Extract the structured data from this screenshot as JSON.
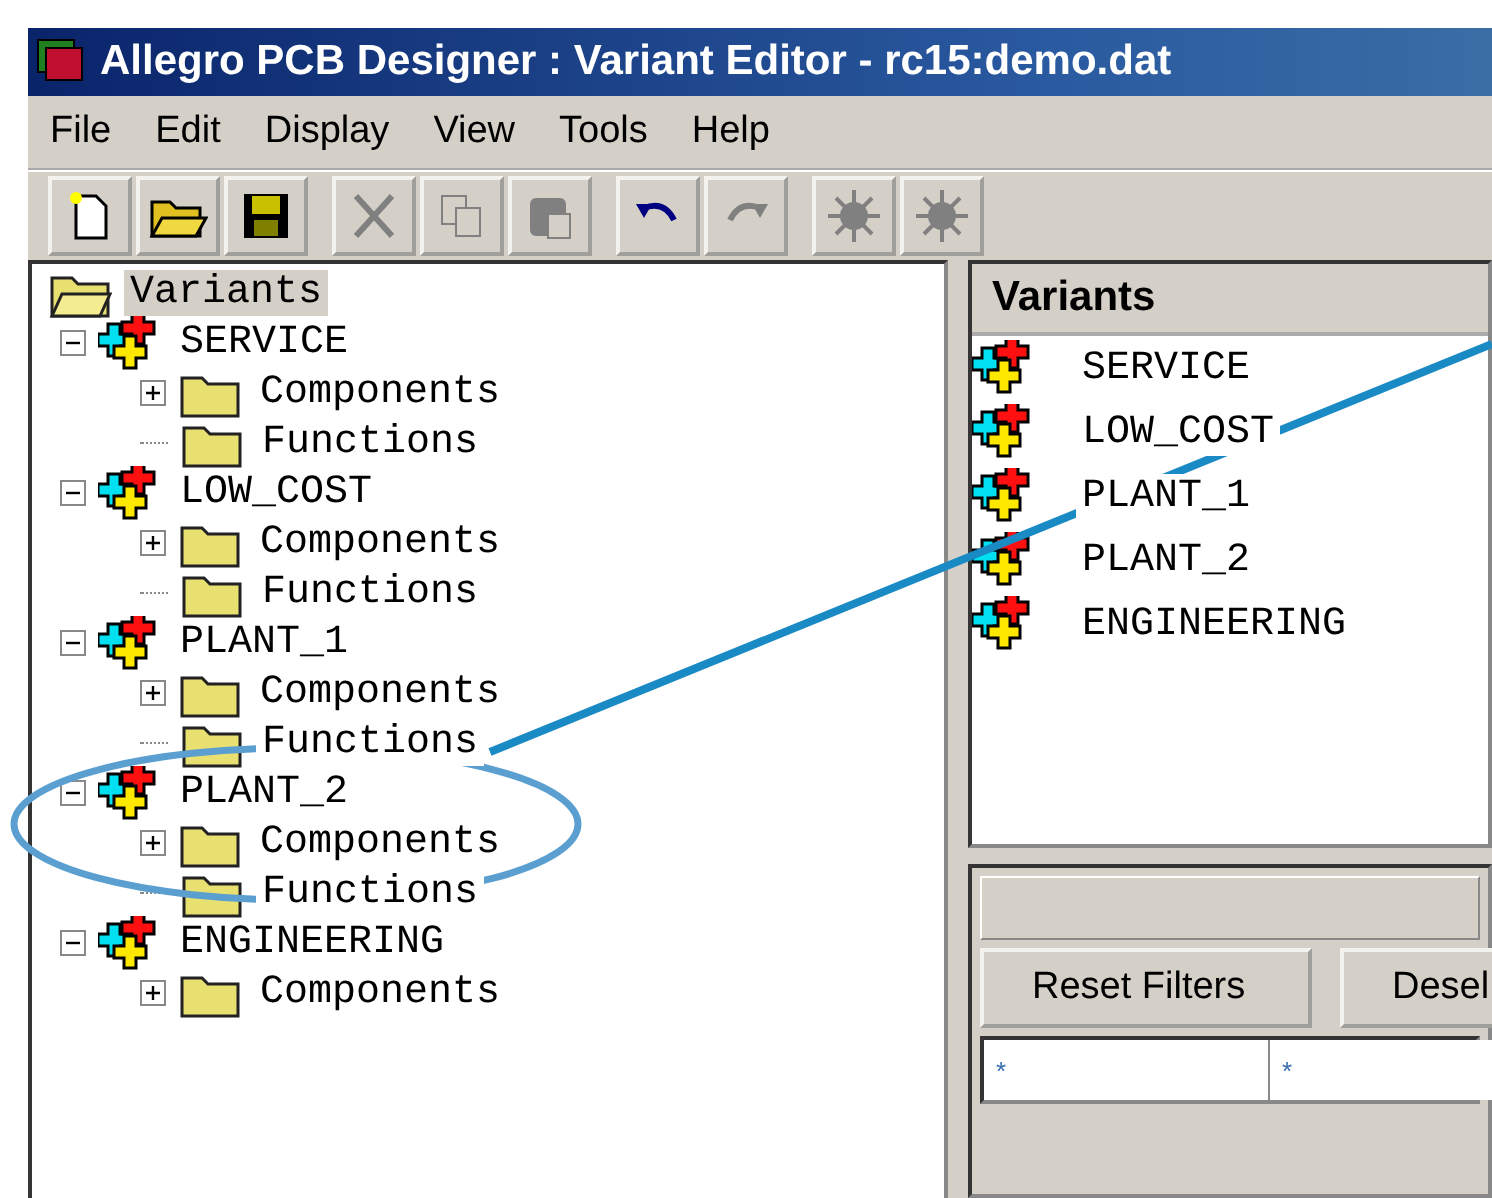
{
  "window": {
    "title": "Allegro PCB Designer : Variant Editor - rc15:demo.dat"
  },
  "menu": [
    "File",
    "Edit",
    "Display",
    "View",
    "Tools",
    "Help"
  ],
  "toolbar": [
    [
      {
        "kind": "new",
        "disabled": false
      },
      {
        "kind": "open",
        "disabled": false
      },
      {
        "kind": "save",
        "disabled": false
      }
    ],
    [
      {
        "kind": "cut",
        "disabled": true
      },
      {
        "kind": "copy",
        "disabled": true
      },
      {
        "kind": "paste",
        "disabled": true
      }
    ],
    [
      {
        "kind": "undo",
        "disabled": false
      },
      {
        "kind": "redo",
        "disabled": true
      }
    ],
    [
      {
        "kind": "burst",
        "disabled": true
      },
      {
        "kind": "burst",
        "disabled": true
      }
    ]
  ],
  "tree": {
    "label": "Variants",
    "selected": true,
    "children": [
      {
        "label": "SERVICE",
        "expanded": true,
        "children": [
          {
            "label": "Components",
            "kind": "branch",
            "expanded": false
          },
          {
            "label": "Functions",
            "kind": "leaf"
          }
        ]
      },
      {
        "label": "LOW_COST",
        "expanded": true,
        "children": [
          {
            "label": "Components",
            "kind": "branch",
            "expanded": false
          },
          {
            "label": "Functions",
            "kind": "leaf"
          }
        ]
      },
      {
        "label": "PLANT_1",
        "expanded": true,
        "children": [
          {
            "label": "Components",
            "kind": "branch",
            "expanded": false
          },
          {
            "label": "Functions",
            "kind": "leaf"
          }
        ]
      },
      {
        "label": "PLANT_2",
        "expanded": true,
        "children": [
          {
            "label": "Components",
            "kind": "branch",
            "expanded": false
          },
          {
            "label": "Functions",
            "kind": "leaf"
          }
        ]
      },
      {
        "label": "ENGINEERING",
        "expanded": true,
        "children": [
          {
            "label": "Components",
            "kind": "branch",
            "expanded": false
          }
        ]
      }
    ]
  },
  "list": {
    "header": "Variants",
    "items": [
      "SERVICE",
      "LOW_COST",
      "PLANT_1",
      "PLANT_2",
      "ENGINEERING"
    ]
  },
  "filter_panel": {
    "buttons": [
      "Reset Filters",
      "Desel"
    ],
    "fields": [
      {
        "value": "*"
      },
      {
        "value": "*"
      }
    ]
  }
}
